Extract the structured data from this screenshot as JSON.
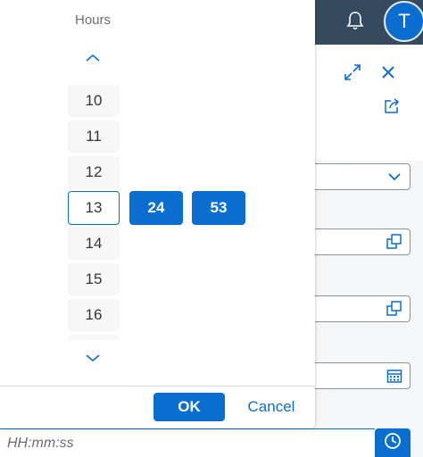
{
  "shell": {
    "avatar_initial": "T",
    "bell_icon": "bell-icon"
  },
  "picker": {
    "column_label": "Hours",
    "hours": [
      "10",
      "11",
      "12",
      "13",
      "14",
      "15",
      "16"
    ],
    "selected_hour": "13",
    "minutes": "24",
    "seconds": "53",
    "ok_label": "OK",
    "cancel_label": "Cancel"
  },
  "time_input": {
    "placeholder": "HH:mm:ss"
  },
  "colors": {
    "accent": "#0a6ed1",
    "shell": "#354a5f"
  }
}
